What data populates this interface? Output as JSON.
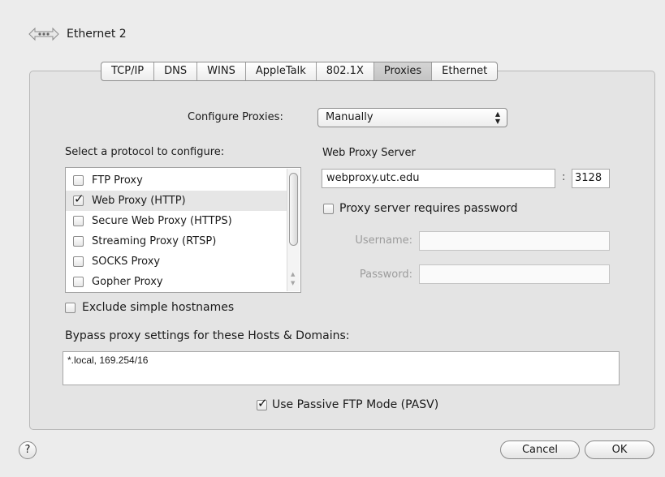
{
  "header": {
    "title": "Ethernet 2",
    "icon": "network-icon"
  },
  "tabs": [
    {
      "label": "TCP/IP"
    },
    {
      "label": "DNS"
    },
    {
      "label": "WINS"
    },
    {
      "label": "AppleTalk"
    },
    {
      "label": "802.1X"
    },
    {
      "label": "Proxies",
      "selected": true
    },
    {
      "label": "Ethernet"
    }
  ],
  "configure": {
    "label": "Configure Proxies:",
    "value": "Manually"
  },
  "protocols": {
    "label": "Select a protocol to configure:",
    "items": [
      {
        "label": "FTP Proxy",
        "checked": false
      },
      {
        "label": "Web Proxy (HTTP)",
        "checked": true,
        "selected": true
      },
      {
        "label": "Secure Web Proxy (HTTPS)",
        "checked": false
      },
      {
        "label": "Streaming Proxy (RTSP)",
        "checked": false
      },
      {
        "label": "SOCKS Proxy",
        "checked": false
      },
      {
        "label": "Gopher Proxy",
        "checked": false
      }
    ]
  },
  "exclude_simple": {
    "label": "Exclude simple hostnames",
    "checked": false
  },
  "server": {
    "label": "Web Proxy Server",
    "host": "webproxy.utc.edu",
    "colon": ":",
    "port": "3128",
    "requires_password": {
      "label": "Proxy server requires password",
      "checked": false
    },
    "username_label": "Username:",
    "password_label": "Password:"
  },
  "bypass": {
    "label": "Bypass proxy settings for these Hosts & Domains:",
    "value": "*.local, 169.254/16"
  },
  "pasv": {
    "label": "Use Passive FTP Mode (PASV)",
    "checked": true
  },
  "buttons": {
    "help": "?",
    "cancel": "Cancel",
    "ok": "OK"
  }
}
